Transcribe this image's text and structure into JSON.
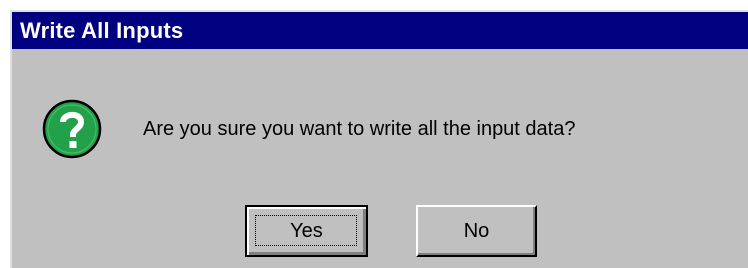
{
  "dialog": {
    "title": "Write All Inputs",
    "message": "Are you sure you want to write all the input data?",
    "icon": "question-icon",
    "buttons": {
      "yes_label": "Yes",
      "no_label": "No"
    },
    "default_button": "Yes"
  },
  "colors": {
    "titlebar": "#000080",
    "title_text": "#ffffff",
    "dialog_face": "#c0c0c0",
    "icon_fill": "#22a14a"
  }
}
